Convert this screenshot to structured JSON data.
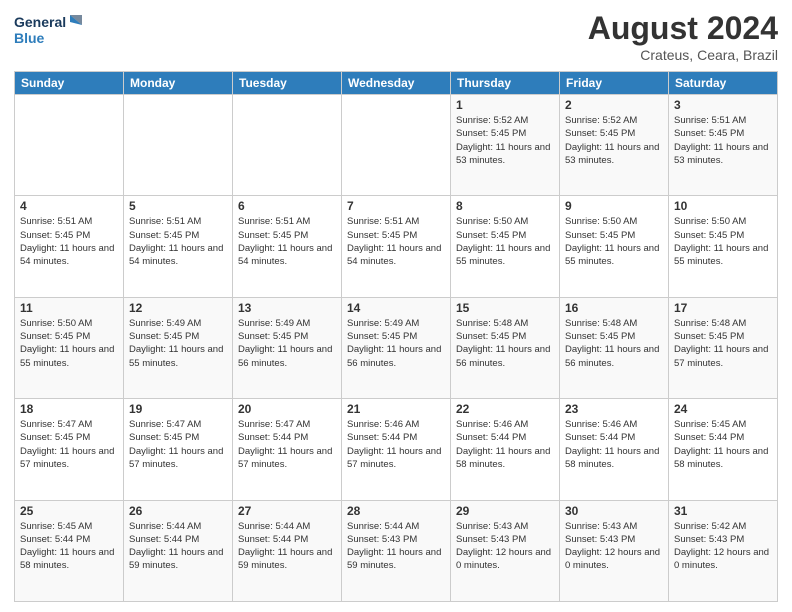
{
  "logo": {
    "line1": "General",
    "line2": "Blue"
  },
  "title": "August 2024",
  "subtitle": "Crateus, Ceara, Brazil",
  "weekdays": [
    "Sunday",
    "Monday",
    "Tuesday",
    "Wednesday",
    "Thursday",
    "Friday",
    "Saturday"
  ],
  "weeks": [
    [
      {
        "day": "",
        "sunrise": "",
        "sunset": "",
        "daylight": ""
      },
      {
        "day": "",
        "sunrise": "",
        "sunset": "",
        "daylight": ""
      },
      {
        "day": "",
        "sunrise": "",
        "sunset": "",
        "daylight": ""
      },
      {
        "day": "",
        "sunrise": "",
        "sunset": "",
        "daylight": ""
      },
      {
        "day": "1",
        "sunrise": "Sunrise: 5:52 AM",
        "sunset": "Sunset: 5:45 PM",
        "daylight": "Daylight: 11 hours and 53 minutes."
      },
      {
        "day": "2",
        "sunrise": "Sunrise: 5:52 AM",
        "sunset": "Sunset: 5:45 PM",
        "daylight": "Daylight: 11 hours and 53 minutes."
      },
      {
        "day": "3",
        "sunrise": "Sunrise: 5:51 AM",
        "sunset": "Sunset: 5:45 PM",
        "daylight": "Daylight: 11 hours and 53 minutes."
      }
    ],
    [
      {
        "day": "4",
        "sunrise": "Sunrise: 5:51 AM",
        "sunset": "Sunset: 5:45 PM",
        "daylight": "Daylight: 11 hours and 54 minutes."
      },
      {
        "day": "5",
        "sunrise": "Sunrise: 5:51 AM",
        "sunset": "Sunset: 5:45 PM",
        "daylight": "Daylight: 11 hours and 54 minutes."
      },
      {
        "day": "6",
        "sunrise": "Sunrise: 5:51 AM",
        "sunset": "Sunset: 5:45 PM",
        "daylight": "Daylight: 11 hours and 54 minutes."
      },
      {
        "day": "7",
        "sunrise": "Sunrise: 5:51 AM",
        "sunset": "Sunset: 5:45 PM",
        "daylight": "Daylight: 11 hours and 54 minutes."
      },
      {
        "day": "8",
        "sunrise": "Sunrise: 5:50 AM",
        "sunset": "Sunset: 5:45 PM",
        "daylight": "Daylight: 11 hours and 55 minutes."
      },
      {
        "day": "9",
        "sunrise": "Sunrise: 5:50 AM",
        "sunset": "Sunset: 5:45 PM",
        "daylight": "Daylight: 11 hours and 55 minutes."
      },
      {
        "day": "10",
        "sunrise": "Sunrise: 5:50 AM",
        "sunset": "Sunset: 5:45 PM",
        "daylight": "Daylight: 11 hours and 55 minutes."
      }
    ],
    [
      {
        "day": "11",
        "sunrise": "Sunrise: 5:50 AM",
        "sunset": "Sunset: 5:45 PM",
        "daylight": "Daylight: 11 hours and 55 minutes."
      },
      {
        "day": "12",
        "sunrise": "Sunrise: 5:49 AM",
        "sunset": "Sunset: 5:45 PM",
        "daylight": "Daylight: 11 hours and 55 minutes."
      },
      {
        "day": "13",
        "sunrise": "Sunrise: 5:49 AM",
        "sunset": "Sunset: 5:45 PM",
        "daylight": "Daylight: 11 hours and 56 minutes."
      },
      {
        "day": "14",
        "sunrise": "Sunrise: 5:49 AM",
        "sunset": "Sunset: 5:45 PM",
        "daylight": "Daylight: 11 hours and 56 minutes."
      },
      {
        "day": "15",
        "sunrise": "Sunrise: 5:48 AM",
        "sunset": "Sunset: 5:45 PM",
        "daylight": "Daylight: 11 hours and 56 minutes."
      },
      {
        "day": "16",
        "sunrise": "Sunrise: 5:48 AM",
        "sunset": "Sunset: 5:45 PM",
        "daylight": "Daylight: 11 hours and 56 minutes."
      },
      {
        "day": "17",
        "sunrise": "Sunrise: 5:48 AM",
        "sunset": "Sunset: 5:45 PM",
        "daylight": "Daylight: 11 hours and 57 minutes."
      }
    ],
    [
      {
        "day": "18",
        "sunrise": "Sunrise: 5:47 AM",
        "sunset": "Sunset: 5:45 PM",
        "daylight": "Daylight: 11 hours and 57 minutes."
      },
      {
        "day": "19",
        "sunrise": "Sunrise: 5:47 AM",
        "sunset": "Sunset: 5:45 PM",
        "daylight": "Daylight: 11 hours and 57 minutes."
      },
      {
        "day": "20",
        "sunrise": "Sunrise: 5:47 AM",
        "sunset": "Sunset: 5:44 PM",
        "daylight": "Daylight: 11 hours and 57 minutes."
      },
      {
        "day": "21",
        "sunrise": "Sunrise: 5:46 AM",
        "sunset": "Sunset: 5:44 PM",
        "daylight": "Daylight: 11 hours and 57 minutes."
      },
      {
        "day": "22",
        "sunrise": "Sunrise: 5:46 AM",
        "sunset": "Sunset: 5:44 PM",
        "daylight": "Daylight: 11 hours and 58 minutes."
      },
      {
        "day": "23",
        "sunrise": "Sunrise: 5:46 AM",
        "sunset": "Sunset: 5:44 PM",
        "daylight": "Daylight: 11 hours and 58 minutes."
      },
      {
        "day": "24",
        "sunrise": "Sunrise: 5:45 AM",
        "sunset": "Sunset: 5:44 PM",
        "daylight": "Daylight: 11 hours and 58 minutes."
      }
    ],
    [
      {
        "day": "25",
        "sunrise": "Sunrise: 5:45 AM",
        "sunset": "Sunset: 5:44 PM",
        "daylight": "Daylight: 11 hours and 58 minutes."
      },
      {
        "day": "26",
        "sunrise": "Sunrise: 5:44 AM",
        "sunset": "Sunset: 5:44 PM",
        "daylight": "Daylight: 11 hours and 59 minutes."
      },
      {
        "day": "27",
        "sunrise": "Sunrise: 5:44 AM",
        "sunset": "Sunset: 5:44 PM",
        "daylight": "Daylight: 11 hours and 59 minutes."
      },
      {
        "day": "28",
        "sunrise": "Sunrise: 5:44 AM",
        "sunset": "Sunset: 5:43 PM",
        "daylight": "Daylight: 11 hours and 59 minutes."
      },
      {
        "day": "29",
        "sunrise": "Sunrise: 5:43 AM",
        "sunset": "Sunset: 5:43 PM",
        "daylight": "Daylight: 12 hours and 0 minutes."
      },
      {
        "day": "30",
        "sunrise": "Sunrise: 5:43 AM",
        "sunset": "Sunset: 5:43 PM",
        "daylight": "Daylight: 12 hours and 0 minutes."
      },
      {
        "day": "31",
        "sunrise": "Sunrise: 5:42 AM",
        "sunset": "Sunset: 5:43 PM",
        "daylight": "Daylight: 12 hours and 0 minutes."
      }
    ]
  ]
}
